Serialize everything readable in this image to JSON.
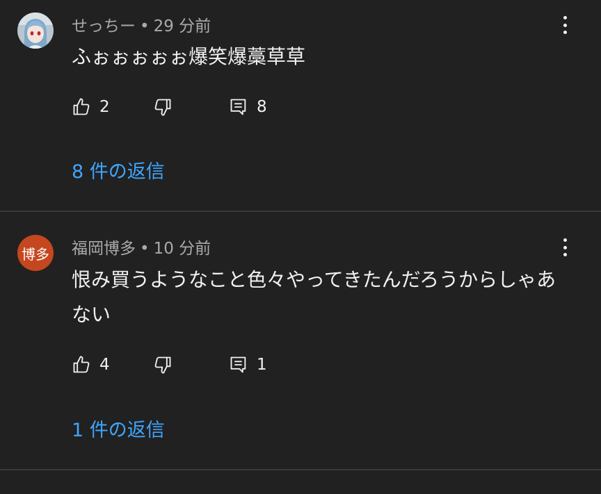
{
  "comments": [
    {
      "author": "せっちー",
      "time": "29 分前",
      "text": "ふぉぉぉぉぉ爆笑爆藁草草",
      "likes": "2",
      "replies_count": "8",
      "replies_link": "8 件の返信",
      "avatar_icon": "anime-character-avatar"
    },
    {
      "author": "福岡博多",
      "time": "10 分前",
      "text": "恨み買うようなこと色々やってきたんだろうからしゃあない",
      "likes": "4",
      "replies_count": "1",
      "replies_link": "1 件の返信",
      "avatar_text": "博多",
      "avatar_color": "#c5471f"
    }
  ],
  "separator": "•",
  "colors": {
    "background": "#212121",
    "link": "#3ea6ff",
    "meta": "#aaaaaa",
    "text": "#f1f1f1"
  },
  "icons": [
    "thumbs-up-icon",
    "thumbs-down-icon",
    "reply-comment-icon",
    "more-vert-icon"
  ]
}
